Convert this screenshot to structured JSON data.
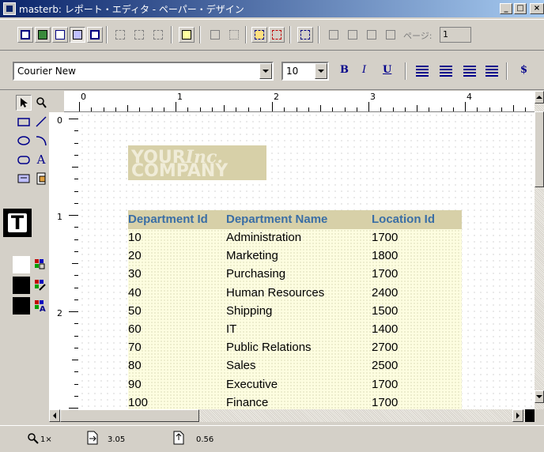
{
  "window": {
    "title": "masterb: レポート・エディタ - ペーパー・デザイン",
    "minimize_label": "_",
    "maximize_label": "□",
    "close_label": "×"
  },
  "toolbar1": {
    "page_label": "ページ:",
    "page_value": "1"
  },
  "toolbar2": {
    "font_name": "Courier New",
    "font_size": "10",
    "bold_label": "B",
    "italic_label": "I",
    "underline_label": "U",
    "currency_label": "$"
  },
  "palette": {
    "text_tool_label": "A",
    "big_text_label": "T"
  },
  "rulers": {
    "h_numbers": [
      "0",
      "1",
      "2",
      "3",
      "4"
    ],
    "v_numbers": [
      "0",
      "1",
      "2"
    ]
  },
  "logo": {
    "line1": "YOUR",
    "line1_italic": "Inc.",
    "line2": "COMPANY"
  },
  "table": {
    "headers": [
      "Department Id",
      "Department Name",
      "Location Id"
    ],
    "rows": [
      [
        "10",
        "Administration",
        "1700"
      ],
      [
        "20",
        "Marketing",
        "1800"
      ],
      [
        "30",
        "Purchasing",
        "1700"
      ],
      [
        "40",
        "Human Resources",
        "2400"
      ],
      [
        "50",
        "Shipping",
        "1500"
      ],
      [
        "60",
        "IT",
        "1400"
      ],
      [
        "70",
        "Public Relations",
        "2700"
      ],
      [
        "80",
        "Sales",
        "2500"
      ],
      [
        "90",
        "Executive",
        "1700"
      ],
      [
        "100",
        "Finance",
        "1700"
      ]
    ]
  },
  "statusbar": {
    "zoom": "1×",
    "x_pos": "3.05",
    "y_pos": "0.56"
  },
  "colors": {
    "header_text": "#3a6ea5",
    "header_band": "#d7d0a8",
    "title_bar": "#0a246a"
  }
}
